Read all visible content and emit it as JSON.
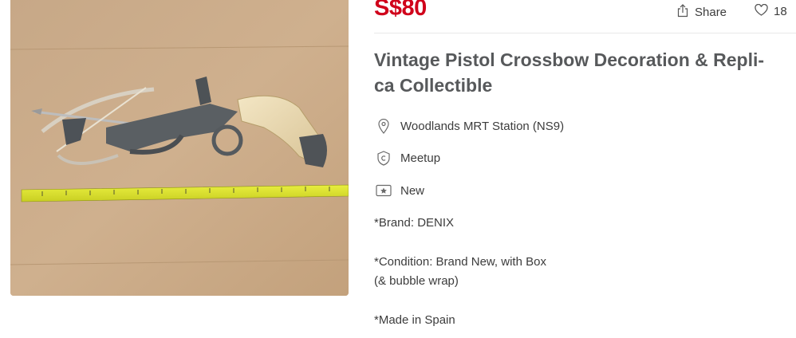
{
  "listing": {
    "price": "S$80",
    "title": "Vintage Pistol Crossbow Decoration & Repli- ca Collectible",
    "photo_alt": "Vintage pistol crossbow replica on cardboard next to a measuring tape",
    "actions": {
      "share_label": "Share",
      "like_count": "18"
    },
    "meta": {
      "location": "Woodlands MRT Station (NS9)",
      "deal_method": "Meetup",
      "condition": "New"
    },
    "description": {
      "brand": "*Brand: DENIX",
      "condition_line1": "*Condition: Brand New, with Box",
      "condition_line2": "(& bubble wrap)",
      "origin": "*Made in Spain"
    }
  },
  "colors": {
    "price": "#d0021b",
    "title": "#57595b",
    "text": "#3c3c3c",
    "icon": "#6a6a6a"
  },
  "icons": {
    "share": "share-icon",
    "like": "heart-icon",
    "location": "location-pin-icon",
    "deal_method": "meetup-icon",
    "condition": "condition-tag-icon"
  }
}
